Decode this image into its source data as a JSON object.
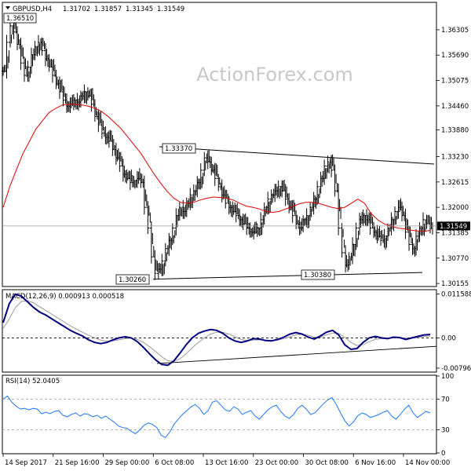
{
  "chart_data": {
    "type": "line",
    "symbol": "GBPUSD,H4",
    "ohlc_header": {
      "open": "1.31702",
      "high": "1.31857",
      "low": "1.31345",
      "close": "1.31549"
    },
    "watermark": "ActionForex.com",
    "x_labels": [
      "14 Sep 2017",
      "21 Sep 16:00",
      "29 Sep 00:00",
      "6 Oct 08:00",
      "13 Oct 16:00",
      "23 Oct 00:00",
      "30 Oct 08:00",
      "6 Nov 16:00",
      "14 Nov 00:00"
    ],
    "price": {
      "ylim": [
        1.301,
        1.3695
      ],
      "y_ticks": [
        "1.36305",
        "1.35690",
        "1.35075",
        "1.34460",
        "1.33880",
        "1.33230",
        "1.32615",
        "1.32000",
        "1.31385",
        "1.30770",
        "1.30155"
      ],
      "current_price": 1.31549,
      "current_label": "1.31549",
      "close": [
        1.353,
        1.36,
        1.364,
        1.3625,
        1.3595,
        1.355,
        1.352,
        1.354,
        1.357,
        1.359,
        1.36,
        1.358,
        1.356,
        1.354,
        1.352,
        1.35,
        1.348,
        1.346,
        1.3445,
        1.345,
        1.346,
        1.3455,
        1.347,
        1.348,
        1.347,
        1.345,
        1.342,
        1.34,
        1.338,
        1.337,
        1.336,
        1.334,
        1.332,
        1.33,
        1.328,
        1.327,
        1.326,
        1.3265,
        1.327,
        1.326,
        1.32,
        1.315,
        1.308,
        1.304,
        1.305,
        1.307,
        1.31,
        1.312,
        1.315,
        1.318,
        1.32,
        1.319,
        1.321,
        1.323,
        1.324,
        1.326,
        1.329,
        1.332,
        1.331,
        1.329,
        1.327,
        1.325,
        1.323,
        1.321,
        1.32,
        1.319,
        1.318,
        1.317,
        1.316,
        1.315,
        1.314,
        1.314,
        1.315,
        1.317,
        1.32,
        1.322,
        1.323,
        1.324,
        1.325,
        1.324,
        1.322,
        1.32,
        1.318,
        1.316,
        1.315,
        1.317,
        1.318,
        1.32,
        1.322,
        1.325,
        1.327,
        1.33,
        1.331,
        1.329,
        1.324,
        1.315,
        1.309,
        1.306,
        1.308,
        1.311,
        1.315,
        1.317,
        1.318,
        1.317,
        1.315,
        1.314,
        1.313,
        1.312,
        1.313,
        1.315,
        1.317,
        1.319,
        1.32,
        1.318,
        1.314,
        1.311,
        1.31,
        1.313,
        1.315,
        1.317,
        1.316,
        1.3155
      ],
      "ma": [
        1.32,
        1.325,
        1.329,
        1.333,
        1.336,
        1.339,
        1.341,
        1.343,
        1.344,
        1.3448,
        1.345,
        1.345,
        1.3448,
        1.3445,
        1.344,
        1.3432,
        1.342,
        1.3405,
        1.339,
        1.337,
        1.335,
        1.333,
        1.3305,
        1.328,
        1.3258,
        1.3238,
        1.3222,
        1.3212,
        1.321,
        1.3212,
        1.3218,
        1.3222,
        1.3225,
        1.3224,
        1.3222,
        1.3218,
        1.321,
        1.3203,
        1.32,
        1.3196,
        1.319,
        1.3188,
        1.319,
        1.3196,
        1.3202,
        1.3208,
        1.3212,
        1.3212,
        1.321,
        1.3205,
        1.32,
        1.3197,
        1.32,
        1.321,
        1.322,
        1.321,
        1.3185,
        1.317,
        1.316,
        1.3155,
        1.315,
        1.3148,
        1.3145,
        1.3143,
        1.3142,
        1.3144
      ],
      "resistance_line": {
        "from": 1.3347,
        "to": 1.3305
      },
      "support_line": {
        "from": 1.3026,
        "to": 1.3042
      },
      "annotations": [
        "1.36510",
        "1.33370",
        "1.30260",
        "1.30380"
      ]
    },
    "macd": {
      "header": "MACD(12,26,9) 0.000913 0.000518",
      "ylim": [
        -0.0088,
        0.0125
      ],
      "y_ticks": [
        "0.011588",
        "0.00",
        "-0.007961"
      ],
      "macd_line": [
        0.004,
        0.009,
        0.0115,
        0.011,
        0.0095,
        0.008,
        0.0068,
        0.006,
        0.005,
        0.004,
        0.003,
        0.002,
        0.0012,
        0.0005,
        -0.0005,
        -0.0012,
        -0.0015,
        -0.0012,
        -0.0005,
        0.0,
        0.0003,
        0.0,
        -0.001,
        -0.0025,
        -0.0042,
        -0.0058,
        -0.007,
        -0.0072,
        -0.006,
        -0.004,
        -0.0018,
        0.0,
        0.0012,
        0.0018,
        0.0022,
        0.002,
        0.0012,
        0.0,
        -0.0008,
        -0.0012,
        -0.0008,
        -0.0002,
        -0.0003,
        -0.0007,
        -0.0008,
        -0.0004,
        0.0002,
        0.001,
        0.0014,
        0.001,
        0.0002,
        -0.0003,
        0.0005,
        0.0015,
        0.002,
        0.0008,
        -0.0018,
        -0.003,
        -0.0028,
        -0.0012,
        0.0,
        0.0004,
        0.0,
        -0.0002,
        0.0002,
        0.0001,
        -0.0004,
        0.0,
        0.0004,
        0.0008,
        0.0009
      ],
      "signal_line": [
        0.0025,
        0.005,
        0.008,
        0.0096,
        0.0098,
        0.0092,
        0.0082,
        0.0072,
        0.0062,
        0.0052,
        0.0042,
        0.0032,
        0.0023,
        0.0015,
        0.0007,
        0.0,
        -0.0006,
        -0.0009,
        -0.0008,
        -0.0005,
        -0.0002,
        -0.0001,
        -0.0004,
        -0.0012,
        -0.0023,
        -0.0036,
        -0.005,
        -0.006,
        -0.0062,
        -0.0055,
        -0.0042,
        -0.0026,
        -0.0012,
        0.0,
        0.001,
        0.0015,
        0.0015,
        0.001,
        0.0003,
        -0.0004,
        -0.0007,
        -0.0006,
        -0.0005,
        -0.0006,
        -0.0007,
        -0.0006,
        -0.0002,
        0.0003,
        0.0008,
        0.001,
        0.0007,
        0.0002,
        0.0002,
        0.0008,
        0.0013,
        0.0012,
        0.0002,
        -0.0012,
        -0.002,
        -0.0018,
        -0.001,
        -0.0004,
        -0.0002,
        -0.0002,
        0.0,
        0.0001,
        -0.0001,
        -0.0001,
        0.0001,
        0.0004,
        0.0005
      ],
      "trend_line": {
        "from": -0.00675,
        "to": -0.00222
      }
    },
    "rsi": {
      "header": "RSI(14) 52.0405",
      "ylim": [
        0,
        100
      ],
      "y_ticks": [
        100,
        70,
        30,
        0
      ],
      "values": [
        70,
        74,
        66,
        61,
        57,
        58,
        56,
        58,
        57,
        51,
        53,
        51,
        54,
        55,
        49,
        47,
        50,
        52,
        48,
        51,
        50,
        47,
        49,
        45,
        48,
        44,
        40,
        35,
        33,
        32,
        28,
        25,
        30,
        36,
        39,
        37,
        33,
        23,
        20,
        27,
        37,
        44,
        50,
        55,
        60,
        63,
        58,
        50,
        55,
        66,
        68,
        62,
        56,
        54,
        60,
        57,
        50,
        53,
        55,
        48,
        44,
        50,
        56,
        60,
        62,
        54,
        48,
        45,
        50,
        58,
        62,
        57,
        50,
        52,
        58,
        64,
        69,
        72,
        63,
        52,
        42,
        35,
        40,
        48,
        52,
        50,
        46,
        48,
        50,
        53,
        55,
        48,
        44,
        50,
        57,
        62,
        52,
        46,
        50,
        54,
        52
      ],
      "levels": [
        70,
        30
      ]
    }
  }
}
